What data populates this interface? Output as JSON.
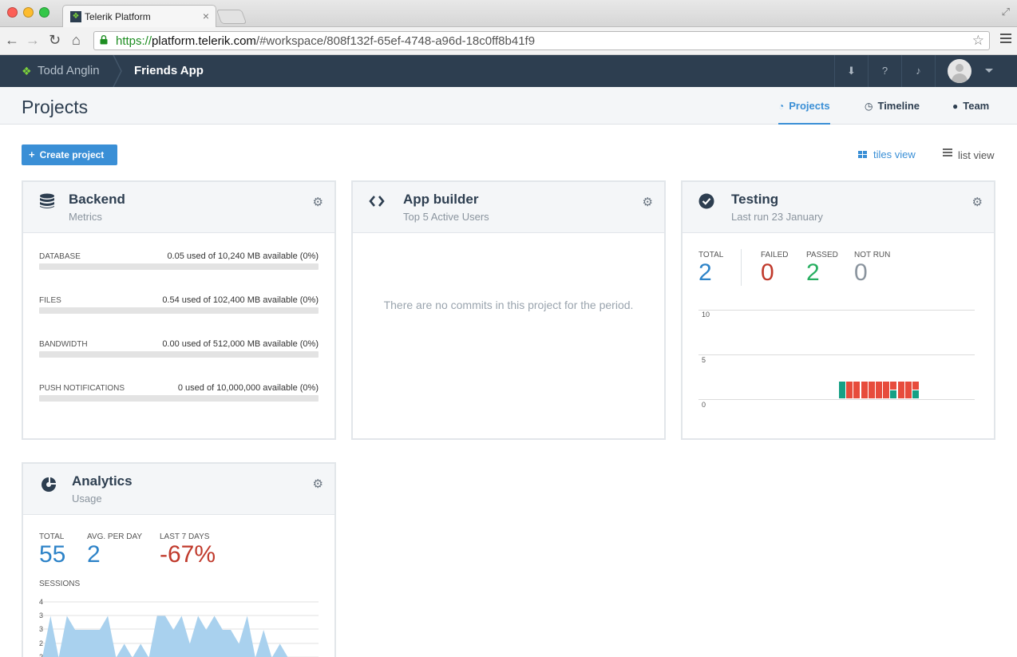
{
  "browser": {
    "tab_title": "Telerik Platform",
    "url_scheme": "https://",
    "url_host": "platform.telerik.com",
    "url_path": "/#workspace/808f132f-65ef-4748-a96d-18c0ff8b41f9"
  },
  "nav": {
    "user_name": "Todd Anglin",
    "app_name": "Friends App",
    "icons": [
      "download-icon",
      "help-icon",
      "bell-icon"
    ]
  },
  "header": {
    "title": "Projects",
    "tabs": [
      {
        "label": "Projects",
        "icon": "dashboard-icon",
        "active": true
      },
      {
        "label": "Timeline",
        "icon": "clock-icon",
        "active": false
      },
      {
        "label": "Team",
        "icon": "user-icon",
        "active": false
      }
    ]
  },
  "toolbar": {
    "create_label": "Create project",
    "tiles_view": "tiles view",
    "list_view": "list view"
  },
  "backend": {
    "title": "Backend",
    "subtitle": "Metrics",
    "metrics": [
      {
        "label": "DATABASE",
        "value": "0.05 used of 10,240 MB available (0%)",
        "percent": 0
      },
      {
        "label": "FILES",
        "value": "0.54 used of 102,400 MB available (0%)",
        "percent": 0
      },
      {
        "label": "BANDWIDTH",
        "value": "0.00 used of 512,000 MB available (0%)",
        "percent": 0
      },
      {
        "label": "PUSH NOTIFICATIONS",
        "value": "0 used of 10,000,000 available (0%)",
        "percent": 0
      }
    ]
  },
  "app_builder": {
    "title": "App builder",
    "subtitle": "Top 5 Active Users",
    "empty_message": "There are no commits in this project for the period."
  },
  "testing": {
    "title": "Testing",
    "subtitle": "Last run 23 January",
    "stats": [
      {
        "label": "TOTAL",
        "value": "2"
      },
      {
        "label": "FAILED",
        "value": "0"
      },
      {
        "label": "PASSED",
        "value": "2"
      },
      {
        "label": "NOT RUN",
        "value": "0"
      }
    ],
    "colors": {
      "passed": "#16a085",
      "failed": "#e74c3c"
    }
  },
  "analytics": {
    "title": "Analytics",
    "subtitle": "Usage",
    "stats": [
      {
        "label": "TOTAL",
        "value": "55"
      },
      {
        "label": "AVG. PER DAY",
        "value": "2"
      },
      {
        "label": "LAST 7 DAYS",
        "value": "-67%"
      }
    ],
    "sessions_label": "SESSIONS"
  },
  "chart_data": [
    {
      "type": "bar",
      "ylim": [
        0,
        10
      ],
      "yticks": [
        "10",
        "5",
        "0"
      ],
      "grid": true,
      "series": [
        {
          "values": [
            2,
            0,
            0,
            0,
            0,
            0,
            0,
            1,
            0,
            0,
            1
          ]
        },
        {
          "values": [
            0,
            2,
            2,
            2,
            2,
            2,
            2,
            1,
            2,
            2,
            1
          ]
        }
      ]
    },
    {
      "type": "area",
      "ylim": [
        0,
        4
      ],
      "yticks": [
        "4",
        "3",
        "3",
        "2",
        "2"
      ],
      "grid": true,
      "values": [
        0,
        3,
        0,
        3,
        2,
        2,
        2,
        2,
        3,
        0,
        1,
        0,
        1,
        0,
        3,
        3,
        2,
        3,
        1,
        3,
        2,
        3,
        2,
        2,
        1,
        3,
        0,
        2,
        0,
        1,
        0
      ]
    }
  ]
}
